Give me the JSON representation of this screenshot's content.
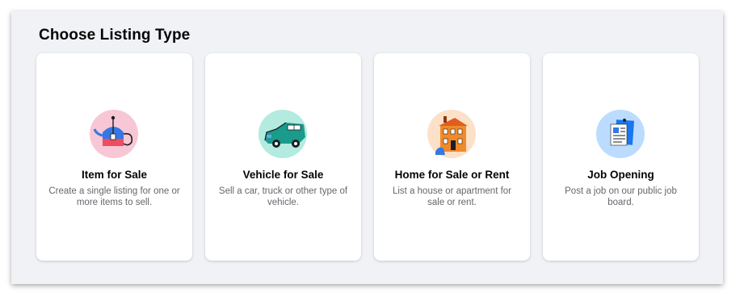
{
  "page": {
    "title": "Choose Listing Type"
  },
  "cards": [
    {
      "name": "Item for Sale",
      "desc": "Create a single listing for one or more items to sell.",
      "icon": "teapot-icon",
      "bg": "#f7c7d5"
    },
    {
      "name": "Vehicle for Sale",
      "desc": "Sell a car, truck or other type of vehicle.",
      "icon": "car-icon",
      "bg": "#b3ebe0"
    },
    {
      "name": "Home for Sale or Rent",
      "desc": "List a house or apartment for sale or rent.",
      "icon": "house-icon",
      "bg": "#fde0c8"
    },
    {
      "name": "Job Opening",
      "desc": "Post a job on our public job board.",
      "icon": "job-board-icon",
      "bg": "#bcdcff"
    }
  ]
}
